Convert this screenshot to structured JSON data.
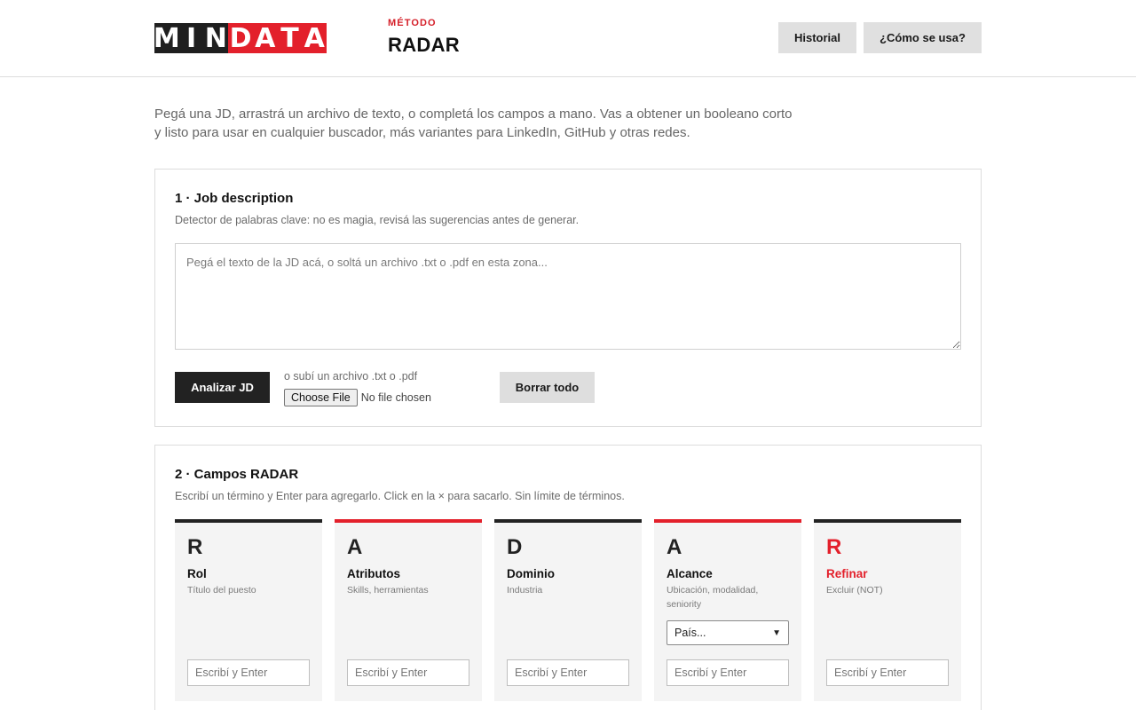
{
  "header": {
    "logo_letters": [
      "M",
      "I",
      "N",
      "D",
      "A",
      "T",
      "A"
    ],
    "brand_sub": "MÉTODO",
    "brand_title": "RADAR",
    "history_label": "Historial",
    "how_label": "¿Cómo se usa?"
  },
  "intro": "Pegá una JD, arrastrá un archivo de texto, o completá los campos a mano. Vas a obtener un booleano corto y listo para usar en cualquier buscador, más variantes para LinkedIn, GitHub y otras redes.",
  "jd_panel": {
    "title": "1 · Job description",
    "desc": "Detector de palabras clave: no es magia, revisá las sugerencias antes de generar.",
    "placeholder": "Pegá el texto de la JD acá, o soltá un archivo .txt o .pdf en esta zona...",
    "analyze_label": "Analizar JD",
    "upload_label": "o subí un archivo .txt o .pdf",
    "file_button": "Choose File",
    "file_status": "No file chosen",
    "clear_label": "Borrar todo"
  },
  "radar_panel": {
    "title": "2 · Campos RADAR",
    "desc": "Escribí un término y Enter para agregarlo. Click en la × para sacarlo. Sin límite de términos.",
    "input_placeholder": "Escribí y Enter",
    "country_select": "País...",
    "cards": [
      {
        "letter": "R",
        "name": "Rol",
        "hint": "Título del puesto"
      },
      {
        "letter": "A",
        "name": "Atributos",
        "hint": "Skills, herramientas"
      },
      {
        "letter": "D",
        "name": "Dominio",
        "hint": "Industria"
      },
      {
        "letter": "A",
        "name": "Alcance",
        "hint": "Ubicación, modalidad, seniority"
      },
      {
        "letter": "R",
        "name": "Refinar",
        "hint": "Excluir (NOT)"
      }
    ]
  },
  "colors": {
    "brand_red": "#e3202b",
    "dark": "#222222",
    "card_bg": "#f4f4f4"
  }
}
